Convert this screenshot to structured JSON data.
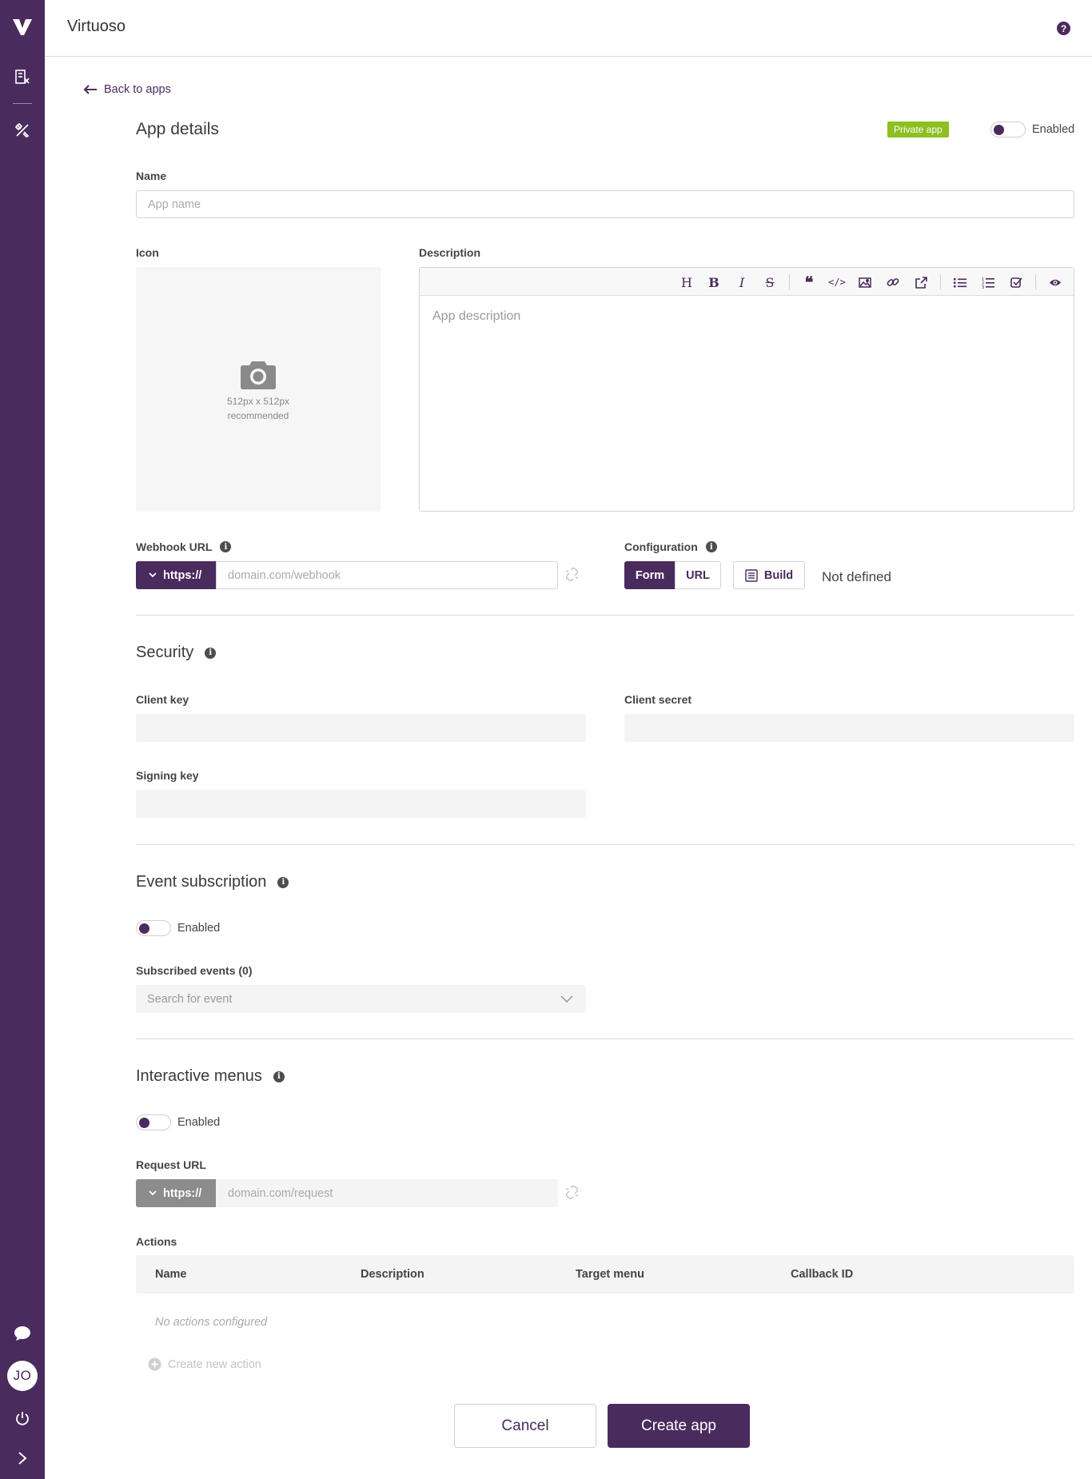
{
  "app": {
    "title": "Virtuoso",
    "logo": "V"
  },
  "sidebar": {
    "user_initials": "JO"
  },
  "nav": {
    "back_label": "Back to apps"
  },
  "app_details": {
    "heading": "App details",
    "badge": "Private app",
    "enabled_label": "Enabled",
    "name_label": "Name",
    "name_placeholder": "App name",
    "icon_label": "Icon",
    "icon_hint_size": "512px x 512px",
    "icon_hint_rec": "recommended",
    "description_label": "Description",
    "description_placeholder": "App description",
    "webhook_label": "Webhook URL",
    "protocol": "https://",
    "webhook_placeholder": "domain.com/webhook",
    "config_label": "Configuration",
    "config_form": "Form",
    "config_url": "URL",
    "config_build": "Build",
    "config_status": "Not defined"
  },
  "security": {
    "heading": "Security",
    "client_key_label": "Client key",
    "client_secret_label": "Client secret",
    "signing_key_label": "Signing key"
  },
  "events": {
    "heading": "Event subscription",
    "enabled_label": "Enabled",
    "subscribed_label": "Subscribed events (0)",
    "search_placeholder": "Search for event"
  },
  "menus": {
    "heading": "Interactive menus",
    "enabled_label": "Enabled",
    "request_label": "Request URL",
    "protocol": "https://",
    "request_placeholder": "domain.com/request",
    "actions_label": "Actions",
    "columns": [
      "Name",
      "Description",
      "Target menu",
      "Callback ID"
    ],
    "empty_text": "No actions configured",
    "create_action": "Create new action"
  },
  "footer": {
    "cancel": "Cancel",
    "create": "Create app"
  },
  "colors": {
    "brand": "#4a2b5e",
    "badge": "#8cbf1f",
    "disabled_protocol": "#8c8c8c"
  }
}
